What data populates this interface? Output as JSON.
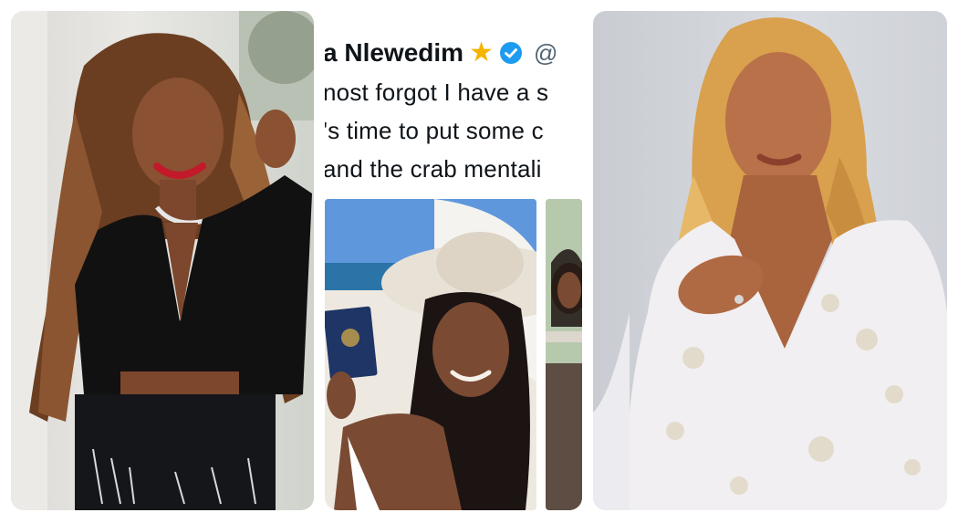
{
  "tweet": {
    "name": "a Nlewedim",
    "handle": "@",
    "lines": [
      "nost forgot I have a s",
      "'s time to put some c",
      "and the crab mentali"
    ]
  },
  "colors": {
    "verified": "#1d9bf0",
    "star": "#f5b400",
    "text": "#0f1419"
  }
}
